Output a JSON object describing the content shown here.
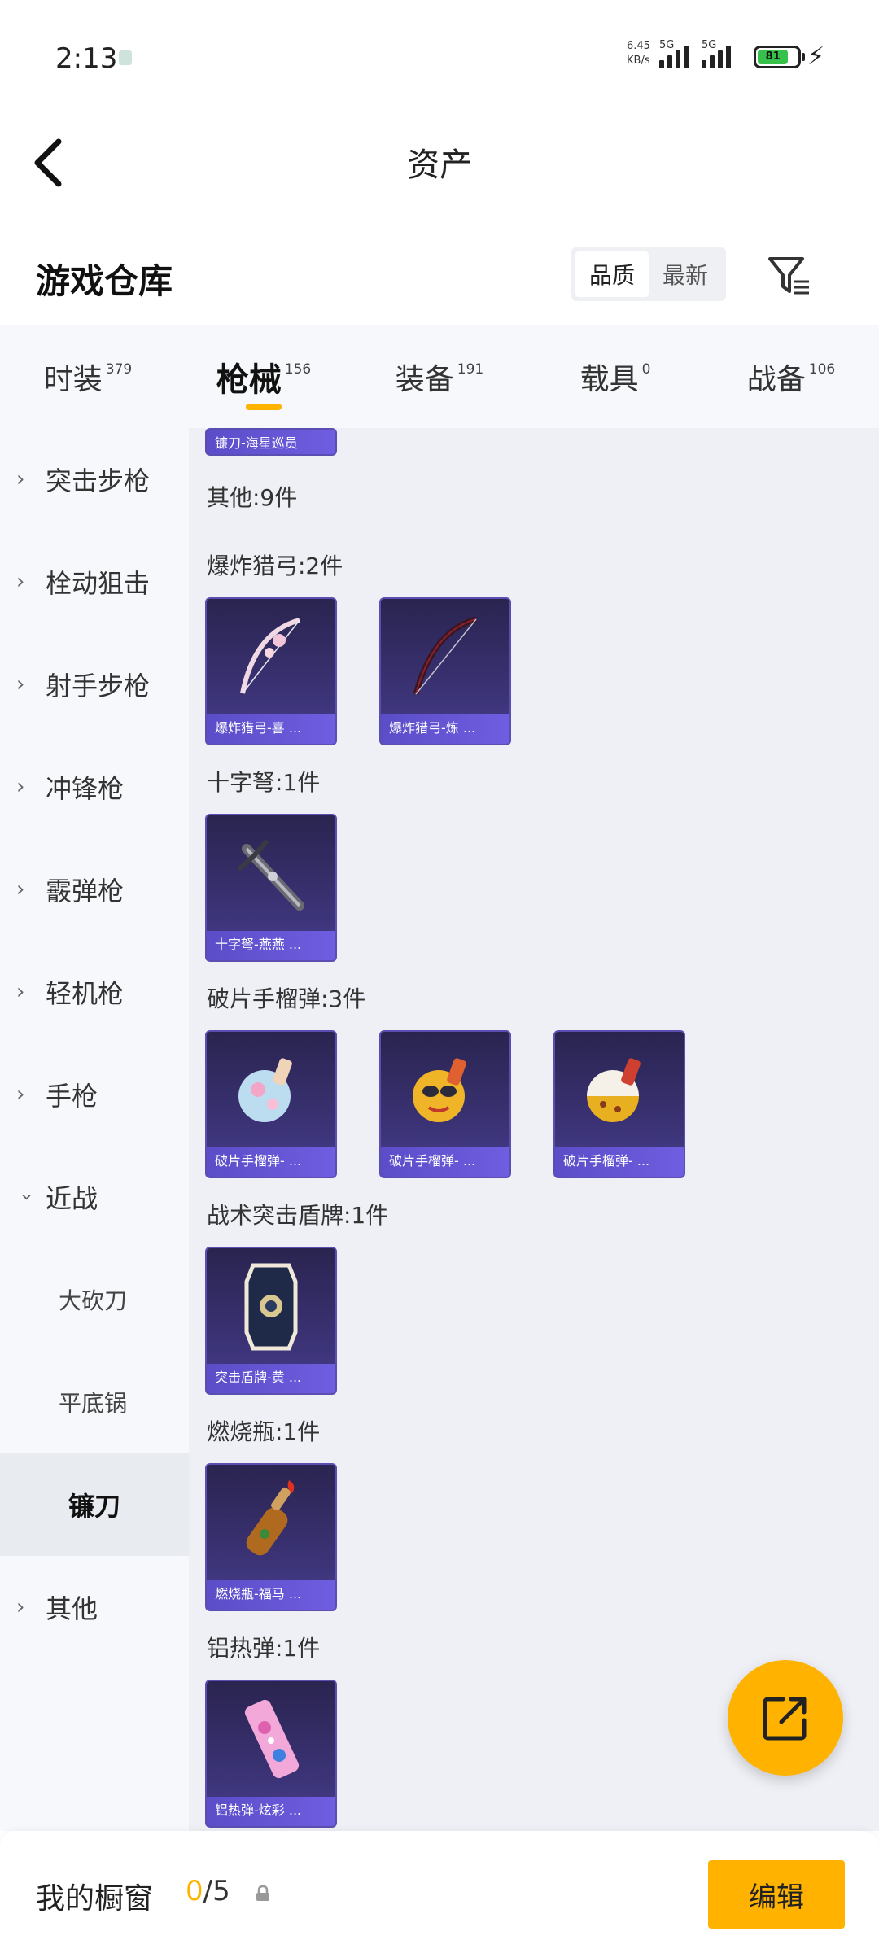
{
  "status_bar": {
    "time": "2:13",
    "net_speed_value": "6.45",
    "net_speed_unit": "KB/s",
    "network_1": "5G",
    "network_2": "5G",
    "battery": "81"
  },
  "header": {
    "title": "资产"
  },
  "section": {
    "title": "游戏仓库",
    "sort_options": [
      "品质",
      "最新"
    ],
    "sort_selected": "品质"
  },
  "tabs": [
    {
      "label": "时装",
      "count": "379"
    },
    {
      "label": "枪械",
      "count": "156",
      "active": true
    },
    {
      "label": "装备",
      "count": "191"
    },
    {
      "label": "载具",
      "count": "0"
    },
    {
      "label": "战备",
      "count": "106"
    }
  ],
  "sidebar": {
    "items": [
      {
        "label": "突击步枪"
      },
      {
        "label": "栓动狙击"
      },
      {
        "label": "射手步枪"
      },
      {
        "label": "冲锋枪"
      },
      {
        "label": "霰弹枪"
      },
      {
        "label": "轻机枪"
      },
      {
        "label": "手枪"
      },
      {
        "label": "近战"
      },
      {
        "label": "大砍刀"
      },
      {
        "label": "平底锅"
      },
      {
        "label": "镰刀"
      },
      {
        "label": "其他"
      }
    ]
  },
  "main": {
    "top_card_caption": "镰刀-海星巡员",
    "groups": [
      {
        "label": "其他:9件"
      },
      {
        "label": "爆炸猎弓:2件",
        "items": [
          "爆炸猎弓-喜 ...",
          "爆炸猎弓-炼 ..."
        ]
      },
      {
        "label": "十字弩:1件",
        "items": [
          "十字弩-燕燕 ..."
        ]
      },
      {
        "label": "破片手榴弹:3件",
        "items": [
          "破片手榴弹- ...",
          "破片手榴弹- ...",
          "破片手榴弹- ..."
        ]
      },
      {
        "label": "战术突击盾牌:1件",
        "items": [
          "突击盾牌-黄 ..."
        ]
      },
      {
        "label": "燃烧瓶:1件",
        "items": [
          "燃烧瓶-福马 ..."
        ]
      },
      {
        "label": "铝热弹:1件",
        "items": [
          "铝热弹-炫彩 ..."
        ]
      }
    ]
  },
  "bottom": {
    "showcase_label": "我的橱窗",
    "showcase_current": "0",
    "showcase_total": "/5",
    "edit_label": "编辑"
  },
  "colors": {
    "accent": "#ffb300",
    "card_bg": "#3c3478",
    "card_caption": "#6f5ee0"
  }
}
